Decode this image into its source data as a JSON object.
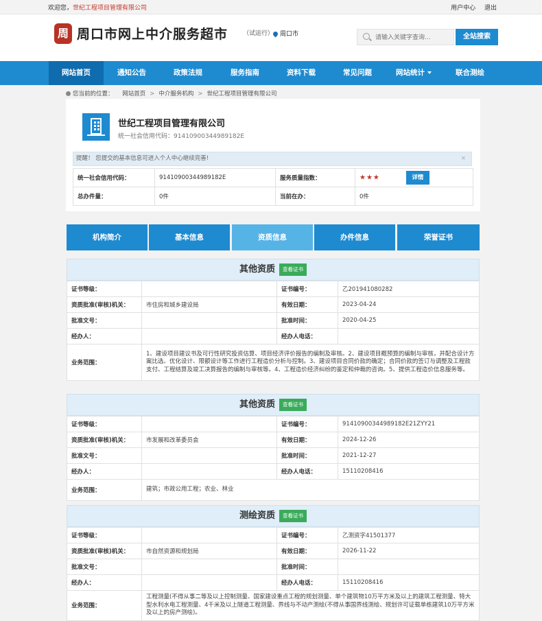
{
  "topbar": {
    "welcome": "欢迎您，",
    "org": "世纪工程项目管理有限公司",
    "user_center": "用户中心",
    "logout": "退出"
  },
  "header": {
    "logo_char": "周",
    "site_title": "周口市网上中介服务超市",
    "trial": "（试运行）",
    "city": "周口市",
    "search_placeholder": "请输入关键字查询...",
    "search_button": "全站搜索"
  },
  "nav": {
    "items": [
      {
        "label": "网站首页"
      },
      {
        "label": "通知公告"
      },
      {
        "label": "政策法规"
      },
      {
        "label": "服务指南"
      },
      {
        "label": "资料下载"
      },
      {
        "label": "常见问题"
      },
      {
        "label": "网站统计"
      },
      {
        "label": "联合测绘"
      }
    ]
  },
  "breadcrumb": {
    "prefix": "您当前的位置：",
    "items": [
      "网站首页",
      "中介服务机构",
      "世纪工程项目管理有限公司"
    ]
  },
  "company": {
    "name": "世纪工程项目管理有限公司",
    "code_label": "统一社会信用代码：",
    "code": "91410900344989182E",
    "notice": "提醒！ 您提交的基本信息可进入个人中心继续完善!",
    "info": {
      "code_label": "统一社会信用代码：",
      "code": "91410900344989182E",
      "quality_label": "服务质量指数：",
      "stars": "★★★",
      "detail_button": "详情",
      "total_label": "总办件量：",
      "total": "0件",
      "current_label": "当前在办：",
      "current": "0件"
    }
  },
  "tabs": [
    {
      "label": "机构简介"
    },
    {
      "label": "基本信息"
    },
    {
      "label": "资质信息"
    },
    {
      "label": "办件信息"
    },
    {
      "label": "荣誉证书"
    }
  ],
  "labels": {
    "level": "证书等级：",
    "cert_no": "证书编号：",
    "authority": "资质批准(审核)机关：",
    "valid": "有效日期：",
    "approval_no": "批准文号：",
    "approval_time": "批准时间：",
    "handler": "经办人：",
    "handler_phone": "经办人电话：",
    "scope": "业务范围："
  },
  "sections": [
    {
      "title": "其他资质",
      "view_button": "查看证书",
      "level": "",
      "cert_no": "乙201941080282",
      "authority": "市住房和城乡建设局",
      "valid": "2023-04-24",
      "approval_no": "",
      "approval_time": "2020-04-25",
      "handler": "",
      "handler_phone": "",
      "scope": "1、建设项目建议书及可行性研究投资估算、项目经济评价报告的编制及审核。2、建设项目概预算的编制与审核，并配合设计方案比选、优化设计、限额设计等工作进行工程造价分析与控制。3、建设项目合同价款的确定；合同价款的签订与调整及工程款支付、工程结算及竣工决算报告的编制与审核等。4、工程造价经济纠纷的鉴定和仲裁的咨询。5、提供工程造价信息服务等。"
    },
    {
      "title": "其他资质",
      "view_button": "查看证书",
      "level": "",
      "cert_no": "91410900344989182E21ZYY21",
      "authority": "市发展和改革委员会",
      "valid": "2024-12-26",
      "approval_no": "",
      "approval_time": "2021-12-27",
      "handler": "",
      "handler_phone": "15110208416",
      "scope": "建筑；市政公用工程；农业、林业"
    },
    {
      "title": "测绘资质",
      "view_button": "查看证书",
      "level": "",
      "cert_no": "乙测资字41501377",
      "authority": "市自然资源和规划局",
      "valid": "2026-11-22",
      "approval_no": "",
      "approval_time": "",
      "handler": "",
      "handler_phone": "15110208416",
      "scope": "工程测量(不得从事二等及以上控制测量、国家建设重点工程的规划测量、单个建筑物10万平方米及以上的建筑工程测量、特大型水利水电工程测量、4千米及以上隧道工程测量、界线与不动产测绘(不得从事国界线测绘、规划许可证载单栋建筑10万平方米及以上的房产测绘)。"
    }
  ]
}
